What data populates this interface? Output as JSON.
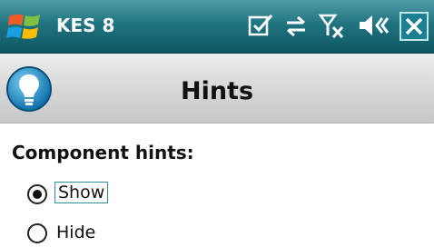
{
  "titlebar": {
    "app_name": "KES 8",
    "icons": [
      "windows-start-icon",
      "notification-checkbox-icon",
      "connectivity-arrows-icon",
      "signal-no-service-icon",
      "speaker-muted-icon",
      "close-icon"
    ]
  },
  "header": {
    "title": "Hints",
    "icon": "lightbulb-icon"
  },
  "content": {
    "section_label": "Component hints:",
    "options": [
      {
        "label": "Show",
        "selected": true
      },
      {
        "label": "Hide",
        "selected": false
      }
    ]
  },
  "colors": {
    "titlebar": "#1f7480",
    "header_background": "#d6d6d6",
    "focus_border": "#2a8fa3"
  }
}
